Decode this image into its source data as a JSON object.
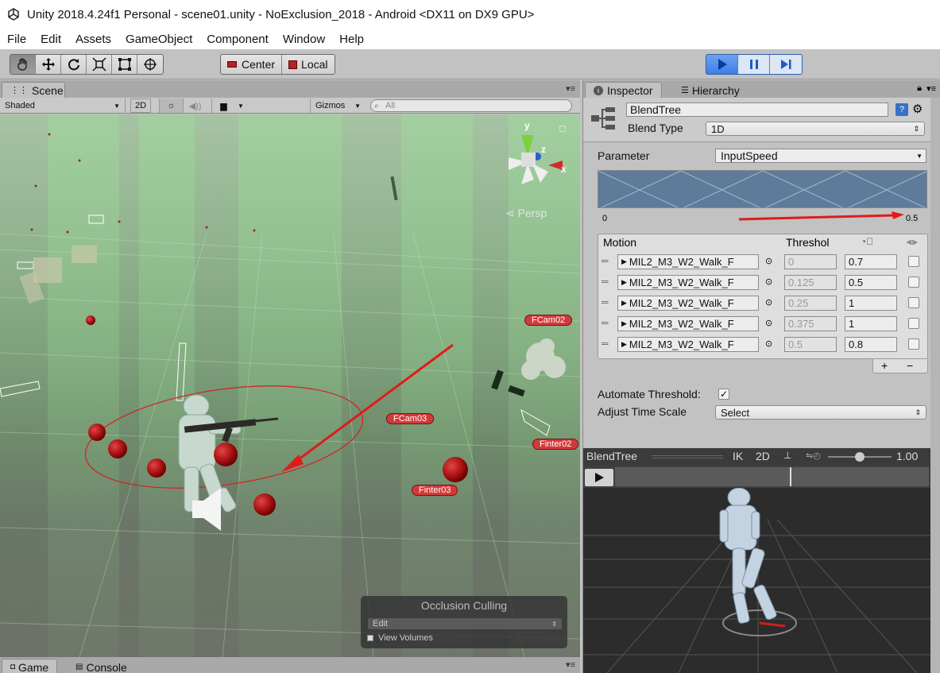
{
  "window": {
    "title": "Unity 2018.4.24f1 Personal - scene01.unity - NoExclusion_2018 - Android <DX11 on DX9 GPU>"
  },
  "menu": [
    "File",
    "Edit",
    "Assets",
    "GameObject",
    "Component",
    "Window",
    "Help"
  ],
  "toolbar": {
    "tools": [
      "hand-icon",
      "move-icon",
      "rotate-icon",
      "scale-icon",
      "rect-icon",
      "transform-icon"
    ],
    "pivot_label": "Center",
    "space_label": "Local"
  },
  "scene_panel": {
    "tab_label": "Scene",
    "shading_mode": "Shaded",
    "mode_2d": "2D",
    "gizmos_label": "Gizmos",
    "search_placeholder": "All",
    "persp_label": "Persp",
    "gizmo_axes": {
      "y": "y",
      "x": "x",
      "z": "z"
    },
    "camera_labels": [
      "FCam02",
      "FCam03",
      "Finter02",
      "Finter03"
    ],
    "occlusion": {
      "title": "Occlusion Culling",
      "mode": "Edit",
      "view_volumes_label": "View Volumes"
    },
    "bottom_tabs": [
      "Game",
      "Console"
    ]
  },
  "inspector": {
    "tabs": [
      "Inspector",
      "Hierarchy"
    ],
    "object_name": "BlendTree",
    "blend_type_label": "Blend Type",
    "blend_type_value": "1D",
    "parameter_label": "Parameter",
    "parameter_value": "InputSpeed",
    "graph_min": "0",
    "graph_max": "0.5",
    "graph_marker_fraction": 1.0,
    "motion_header": "Motion",
    "threshold_header": "Threshol",
    "motions": [
      {
        "clip": "MIL2_M3_W2_Walk_F",
        "threshold": "0",
        "speed": "0.7"
      },
      {
        "clip": "MIL2_M3_W2_Walk_F",
        "threshold": "0.125",
        "speed": "0.5"
      },
      {
        "clip": "MIL2_M3_W2_Walk_F",
        "threshold": "0.25",
        "speed": "1"
      },
      {
        "clip": "MIL2_M3_W2_Walk_F",
        "threshold": "0.375",
        "speed": "1"
      },
      {
        "clip": "MIL2_M3_W2_Walk_F",
        "threshold": "0.5",
        "speed": "0.8"
      }
    ],
    "add_label": "+",
    "remove_label": "−",
    "automate_threshold_label": "Automate Threshold",
    "automate_threshold_checked": true,
    "adjust_time_scale_label": "Adjust Time Scale",
    "adjust_time_scale_value": "Select"
  },
  "preview": {
    "title": "BlendTree",
    "ik_label": "IK",
    "mode_2d": "2D",
    "speed_value": "1.00",
    "speed_fraction": 0.5
  },
  "colors": {
    "play_blue": "#3d7fe6",
    "annotation_red": "#e01b1b",
    "camera_label_red": "#d23a3a"
  }
}
